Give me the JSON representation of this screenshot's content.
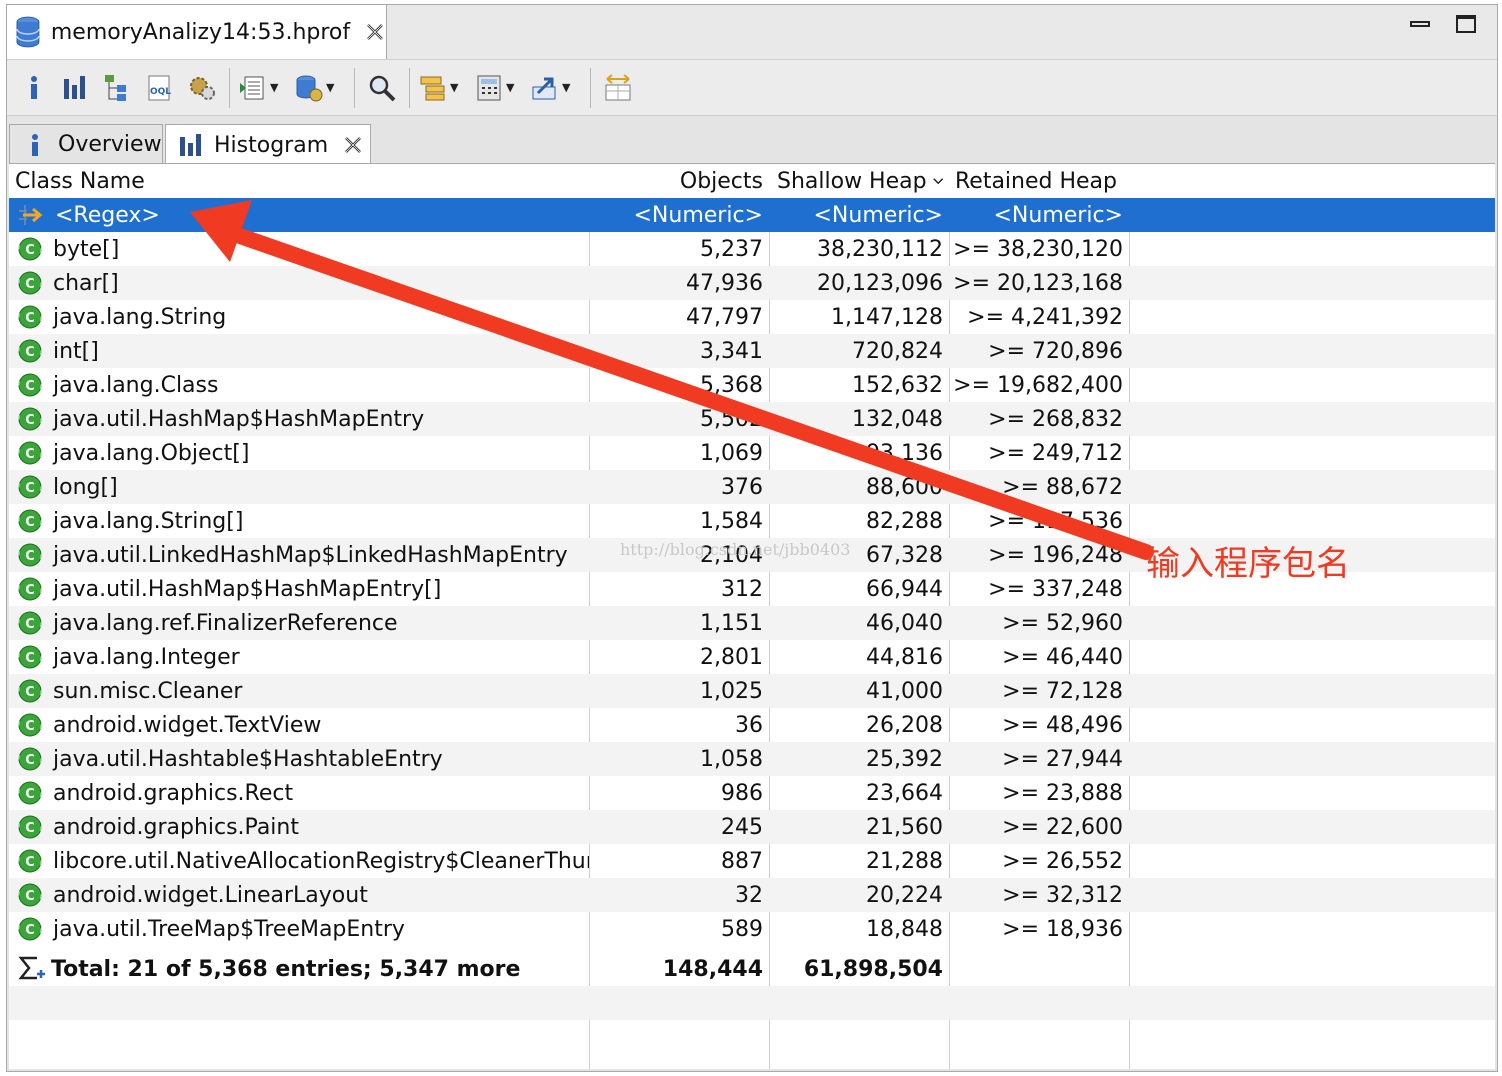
{
  "editor_tab": {
    "title": "memoryAnalizy14:53.hprof"
  },
  "toolbar": {
    "icons": [
      "info-icon",
      "histogram-icon",
      "dominator-tree-icon",
      "oql-icon",
      "thread-overview-icon",
      "reports-icon",
      "heap-dump-icon",
      "search-icon",
      "group-icon",
      "calculate-icon",
      "export-icon",
      "compare-icon"
    ]
  },
  "view_tabs": [
    {
      "label": "Overview"
    },
    {
      "label": "Histogram"
    }
  ],
  "table": {
    "columns": {
      "class_name": "Class Name",
      "objects": "Objects",
      "shallow_heap": "Shallow Heap",
      "retained_heap": "Retained Heap"
    },
    "filter_row": {
      "name": "<Regex>",
      "objects": "<Numeric>",
      "shallow_heap": "<Numeric>",
      "retained_heap": "<Numeric>"
    },
    "rows": [
      {
        "name": "byte[]",
        "objects": "5,237",
        "shallow": "38,230,112",
        "retained": ">= 38,230,120"
      },
      {
        "name": "char[]",
        "objects": "47,936",
        "shallow": "20,123,096",
        "retained": ">= 20,123,168"
      },
      {
        "name": "java.lang.String",
        "objects": "47,797",
        "shallow": "1,147,128",
        "retained": ">= 4,241,392"
      },
      {
        "name": "int[]",
        "objects": "3,341",
        "shallow": "720,824",
        "retained": ">= 720,896"
      },
      {
        "name": "java.lang.Class",
        "objects": "5,368",
        "shallow": "152,632",
        "retained": ">= 19,682,400"
      },
      {
        "name": "java.util.HashMap$HashMapEntry",
        "objects": "5,502",
        "shallow": "132,048",
        "retained": ">= 268,832"
      },
      {
        "name": "java.lang.Object[]",
        "objects": "1,069",
        "shallow": "93,136",
        "retained": ">= 249,712"
      },
      {
        "name": "long[]",
        "objects": "376",
        "shallow": "88,600",
        "retained": ">= 88,672"
      },
      {
        "name": "java.lang.String[]",
        "objects": "1,584",
        "shallow": "82,288",
        "retained": ">= 117,536"
      },
      {
        "name": "java.util.LinkedHashMap$LinkedHashMapEntry",
        "objects": "2,104",
        "shallow": "67,328",
        "retained": ">= 196,248"
      },
      {
        "name": "java.util.HashMap$HashMapEntry[]",
        "objects": "312",
        "shallow": "66,944",
        "retained": ">= 337,248"
      },
      {
        "name": "java.lang.ref.FinalizerReference",
        "objects": "1,151",
        "shallow": "46,040",
        "retained": ">= 52,960"
      },
      {
        "name": "java.lang.Integer",
        "objects": "2,801",
        "shallow": "44,816",
        "retained": ">= 46,440"
      },
      {
        "name": "sun.misc.Cleaner",
        "objects": "1,025",
        "shallow": "41,000",
        "retained": ">= 72,128"
      },
      {
        "name": "android.widget.TextView",
        "objects": "36",
        "shallow": "26,208",
        "retained": ">= 48,496"
      },
      {
        "name": "java.util.Hashtable$HashtableEntry",
        "objects": "1,058",
        "shallow": "25,392",
        "retained": ">= 27,944"
      },
      {
        "name": "android.graphics.Rect",
        "objects": "986",
        "shallow": "23,664",
        "retained": ">= 23,888"
      },
      {
        "name": "android.graphics.Paint",
        "objects": "245",
        "shallow": "21,560",
        "retained": ">= 22,600"
      },
      {
        "name": "libcore.util.NativeAllocationRegistry$CleanerThunk",
        "objects": "887",
        "shallow": "21,288",
        "retained": ">= 26,552"
      },
      {
        "name": "android.widget.LinearLayout",
        "objects": "32",
        "shallow": "20,224",
        "retained": ">= 32,312"
      },
      {
        "name": "java.util.TreeMap$TreeMapEntry",
        "objects": "589",
        "shallow": "18,848",
        "retained": ">= 18,936"
      }
    ],
    "total": {
      "label": "Total: 21 of 5,368 entries; 5,347 more",
      "objects": "148,444",
      "shallow": "61,898,504"
    }
  },
  "annotation": {
    "text": "输入程序包名"
  },
  "watermark": {
    "text": "http://blog.csdn.net/jbb0403"
  },
  "colors": {
    "selection": "#1f6fd1",
    "annotation": "#f03a22",
    "class_icon": "#3aa63a"
  }
}
